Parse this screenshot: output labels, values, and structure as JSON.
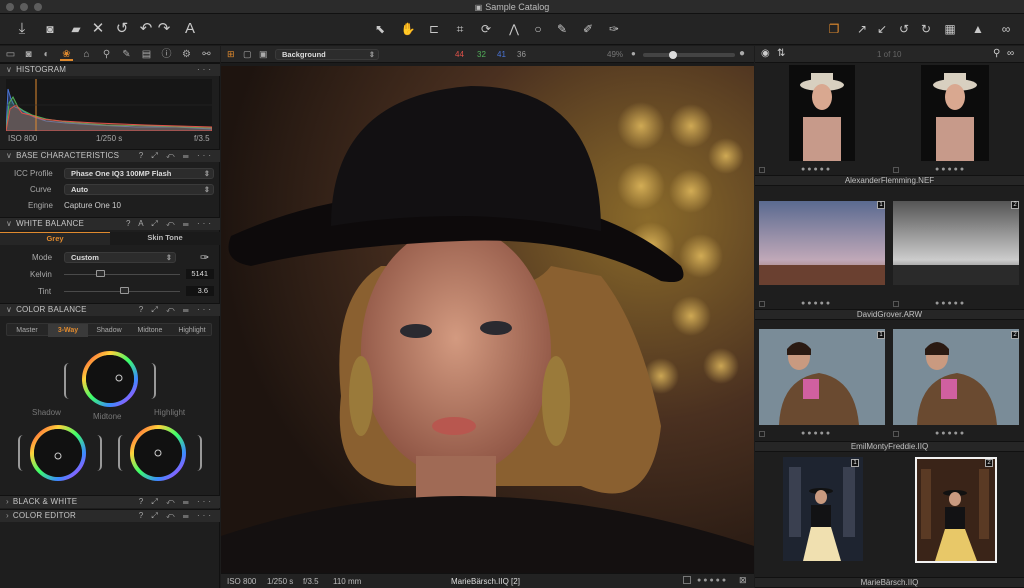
{
  "window": {
    "title": "Sample Catalog"
  },
  "colors": {
    "accent": "#e08a2e",
    "histogram_red": "#e0524a",
    "histogram_green": "#52b05a",
    "histogram_blue": "#4a74d6",
    "selected_tab": "#e08a2e"
  },
  "toolbar": {
    "left_icons": [
      "import-icon",
      "camera-icon",
      "folder-icon",
      "close-icon",
      "undo-all-icon",
      "undo-icon",
      "redo-icon",
      "text-icon"
    ],
    "center_icons": [
      "cursor-icon",
      "hand-icon",
      "crop-icon",
      "transform-icon",
      "rotate-icon",
      "keystone-icon",
      "circle-icon",
      "brush-icon",
      "eyedropper-icon",
      "eraser-icon"
    ],
    "right_icons": [
      "copy-icon",
      "apply-icon",
      "paste-icon",
      "rotate-left-icon",
      "rotate-right-icon",
      "grid-icon",
      "warning-icon",
      "glasses-icon"
    ]
  },
  "histogram": {
    "title": "HISTOGRAM",
    "iso": "ISO 800",
    "shutter": "1/250 s",
    "aperture": "f/3.5"
  },
  "base": {
    "title": "BASE CHARACTERISTICS",
    "icc_label": "ICC Profile",
    "icc_value": "Phase One IQ3 100MP Flash",
    "curve_label": "Curve",
    "curve_value": "Auto",
    "engine_label": "Engine",
    "engine_value": "Capture One 10"
  },
  "wb": {
    "title": "WHITE BALANCE",
    "tab_grey": "Grey",
    "tab_skin": "Skin Tone",
    "mode_label": "Mode",
    "mode_value": "Custom",
    "kelvin_label": "Kelvin",
    "kelvin_value": "5141",
    "kelvin_level": 0.3,
    "tint_label": "Tint",
    "tint_value": "3.6",
    "tint_level": 0.52
  },
  "cb": {
    "title": "COLOR BALANCE",
    "tabs": [
      "Master",
      "3-Way",
      "Shadow",
      "Midtone",
      "Highlight"
    ],
    "active_tab": "3-Way",
    "shadow": "Shadow",
    "midtone": "Midtone",
    "highlight": "Highlight"
  },
  "bw": {
    "title": "BLACK & WHITE"
  },
  "ce": {
    "title": "COLOR EDITOR"
  },
  "viewer": {
    "style_value": "Background",
    "rgb": {
      "r": "44",
      "g": "32",
      "b": "41",
      "l": "36"
    },
    "zoom": "49%",
    "status": {
      "iso": "ISO 800",
      "shutter": "1/250 s",
      "aperture": "f/3.5",
      "focal": "110 mm",
      "filename": "MarieBärsch.IIQ [2]"
    }
  },
  "browser": {
    "count": "1 of 10",
    "groups": [
      {
        "name": "AlexanderFlemming.NEF"
      },
      {
        "name": "DavidGrover.ARW",
        "badges": [
          "1",
          "2"
        ]
      },
      {
        "name": "EmilMontyFreddie.IIQ",
        "badges": [
          "1",
          "2"
        ]
      },
      {
        "name": "MarieBärsch.IIQ",
        "badges": [
          "1",
          "2"
        ]
      }
    ]
  }
}
